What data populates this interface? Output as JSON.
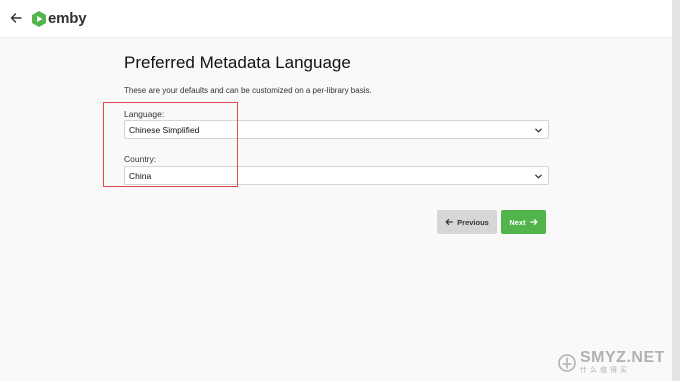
{
  "header": {
    "logo_text": "emby"
  },
  "page": {
    "title": "Preferred Metadata Language",
    "description": "These are your defaults and can be customized on a per-library basis."
  },
  "fields": {
    "language": {
      "label": "Language:",
      "value": "Chinese Simplified"
    },
    "country": {
      "label": "Country:",
      "value": "China"
    }
  },
  "buttons": {
    "previous": "Previous",
    "next": "Next"
  },
  "watermark": {
    "main": "SMYZ.NET",
    "sub": "什么值得买"
  },
  "colors": {
    "accent": "#52b54b",
    "highlight": "#e0474f",
    "secondary_button": "#d6d6d6"
  }
}
